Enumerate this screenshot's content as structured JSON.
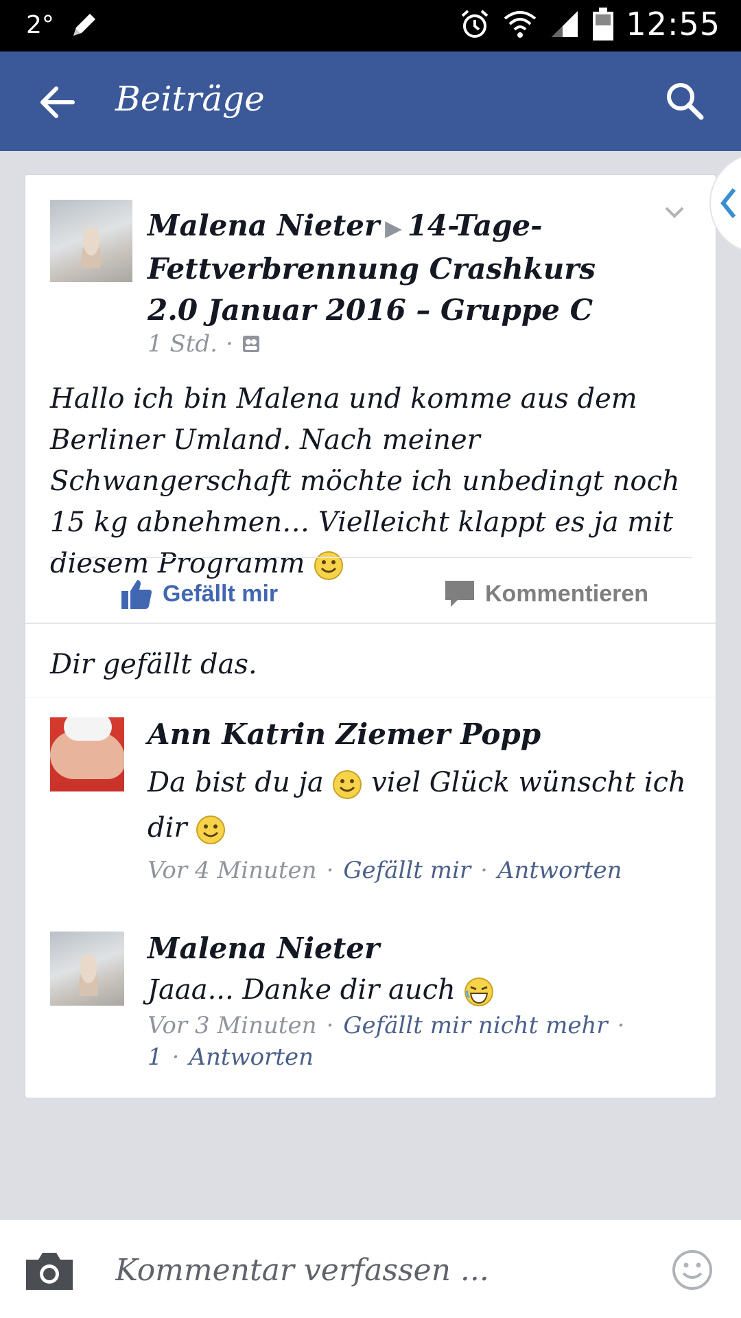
{
  "status_bar": {
    "temperature": "2°",
    "time": "12:55",
    "icons": [
      "pencil-icon",
      "alarm-icon",
      "wifi-icon",
      "signal-icon",
      "battery-icon"
    ]
  },
  "header": {
    "title": "Beiträge",
    "back_icon": "arrow-left-icon",
    "search_icon": "search-icon",
    "background_color": "#3b5998"
  },
  "post": {
    "author": "Malena Nieter",
    "group": "14-Tage-Fettverbrennung Crashkurs 2.0 Januar 2016 – Gruppe C",
    "time": "1 Std.",
    "meta_separator": "·",
    "privacy_icon": "group-icon",
    "body": "Hallo ich bin Malena und komme aus dem Berliner Umland. Nach meiner Schwangerschaft möchte ich unbedingt noch 15 kg abnehmen… Vielleicht klappt es ja mit diesem Programm",
    "actions": {
      "like_label": "Gefällt mir",
      "comment_label": "Kommentieren"
    },
    "likes_text": "Dir gefällt das."
  },
  "comments": [
    {
      "author": "Ann Katrin Ziemer Popp",
      "text_part1": "Da bist du ja",
      "text_part2": "viel Glück wünscht ich dir",
      "time": "Vor 4 Minuten",
      "like_label": "Gefällt mir",
      "reply_label": "Antworten"
    },
    {
      "author": "Malena Nieter",
      "text": "Jaaa... Danke dir auch",
      "time": "Vor 3 Minuten",
      "like_label": "Gefällt mir nicht mehr",
      "like_count": "1",
      "reply_label": "Antworten"
    }
  ],
  "composer": {
    "placeholder": "Kommentar verfassen ...",
    "camera_icon": "camera-icon",
    "emoji_icon": "smiley-icon"
  },
  "colors": {
    "accent": "#4267b2",
    "link": "#4b5f8a",
    "muted": "#90949c",
    "page_bg": "#dcdee3"
  }
}
